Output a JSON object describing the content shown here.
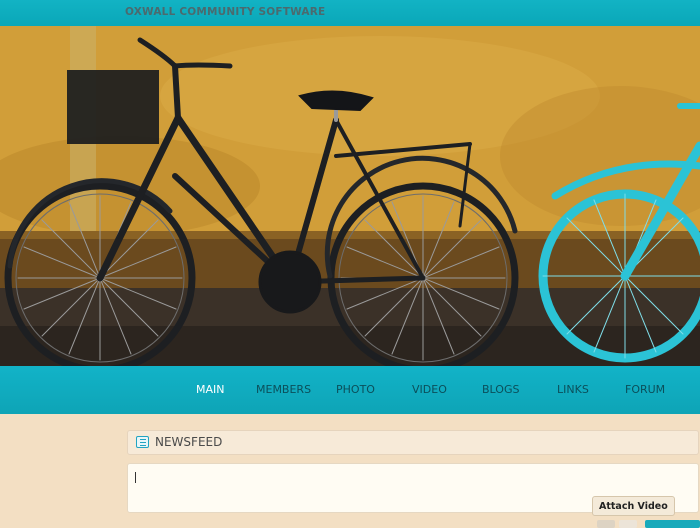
{
  "header": {
    "site_title": "OXWALL COMMUNITY SOFTWARE"
  },
  "nav": {
    "items": [
      {
        "label": "MAIN",
        "active": true
      },
      {
        "label": "MEMBERS",
        "active": false
      },
      {
        "label": "PHOTO",
        "active": false
      },
      {
        "label": "VIDEO",
        "active": false
      },
      {
        "label": "BLOGS",
        "active": false
      },
      {
        "label": "LINKS",
        "active": false
      },
      {
        "label": "FORUM",
        "active": false
      }
    ]
  },
  "newsfeed": {
    "title": "NEWSFEED",
    "status_value": "",
    "attach_label": "Attach Video"
  },
  "colors": {
    "accent": "#12b3c4",
    "background": "#f3dfc3",
    "nav_text": "#0b4f5a",
    "nav_active": "#ffffff"
  }
}
